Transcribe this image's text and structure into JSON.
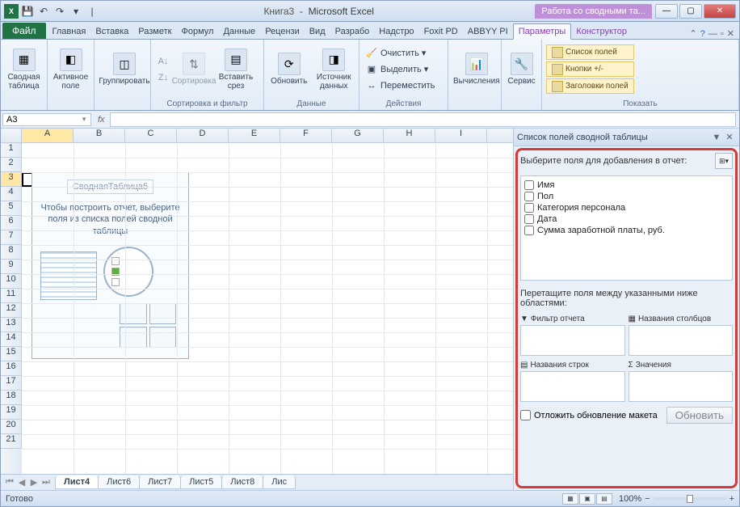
{
  "title": {
    "doc": "Книга3",
    "app": "Microsoft Excel"
  },
  "context_tab": "Работа со сводными та...",
  "qat_icons": [
    "excel",
    "save",
    "undo",
    "redo",
    "print",
    "more"
  ],
  "ribbon_tabs": [
    "Главная",
    "Вставка",
    "Разметк",
    "Формул",
    "Данные",
    "Рецензи",
    "Вид",
    "Разрабо",
    "Надстро",
    "Foxit PD",
    "ABBYY PI"
  ],
  "ribbon_context_tabs": [
    "Параметры",
    "Конструктор"
  ],
  "file_tab": "Файл",
  "ribbon": {
    "pivot_table": "Сводная таблица",
    "active_field": "Активное поле",
    "group": "Группировать",
    "sort_group": "Сортировка и фильтр",
    "sort": "Сортировка",
    "insert_slicer": "Вставить срез",
    "refresh": "Обновить",
    "datasource": "Источник данных",
    "data_group": "Данные",
    "clear": "Очистить",
    "select": "Выделить",
    "move": "Переместить",
    "actions_group": "Действия",
    "calculations": "Вычисления",
    "service": "Сервис",
    "show_group": "Показать",
    "fieldlist_btn": "Список полей",
    "buttons_btn": "Кнопки +/-",
    "headers_btn": "Заголовки полей"
  },
  "namebox": "A3",
  "columns": [
    "A",
    "B",
    "C",
    "D",
    "E",
    "F",
    "G",
    "H",
    "I"
  ],
  "rows": [
    1,
    2,
    3,
    4,
    5,
    6,
    7,
    8,
    9,
    10,
    11,
    12,
    13,
    14,
    15,
    16,
    17,
    18,
    19,
    20,
    21
  ],
  "pivot_placeholder": {
    "name": "СводнаяТаблица5",
    "hint": "Чтобы построить отчет, выберите поля из списка полей сводной таблицы"
  },
  "fieldlist": {
    "title": "Список полей сводной таблицы",
    "instr": "Выберите поля для добавления в отчет:",
    "fields": [
      "Имя",
      "Пол",
      "Категория персонала",
      "Дата",
      "Сумма заработной платы, руб."
    ],
    "drag_instr": "Перетащите поля между указанными ниже областями:",
    "area_filter": "Фильтр отчета",
    "area_cols": "Названия столбцов",
    "area_rows": "Названия строк",
    "area_vals": "Значения",
    "defer": "Отложить обновление макета",
    "update": "Обновить"
  },
  "sheets": [
    "Лист4",
    "Лист6",
    "Лист7",
    "Лист5",
    "Лист8",
    "Лис"
  ],
  "active_sheet": 0,
  "status": "Готово",
  "zoom": "100%"
}
